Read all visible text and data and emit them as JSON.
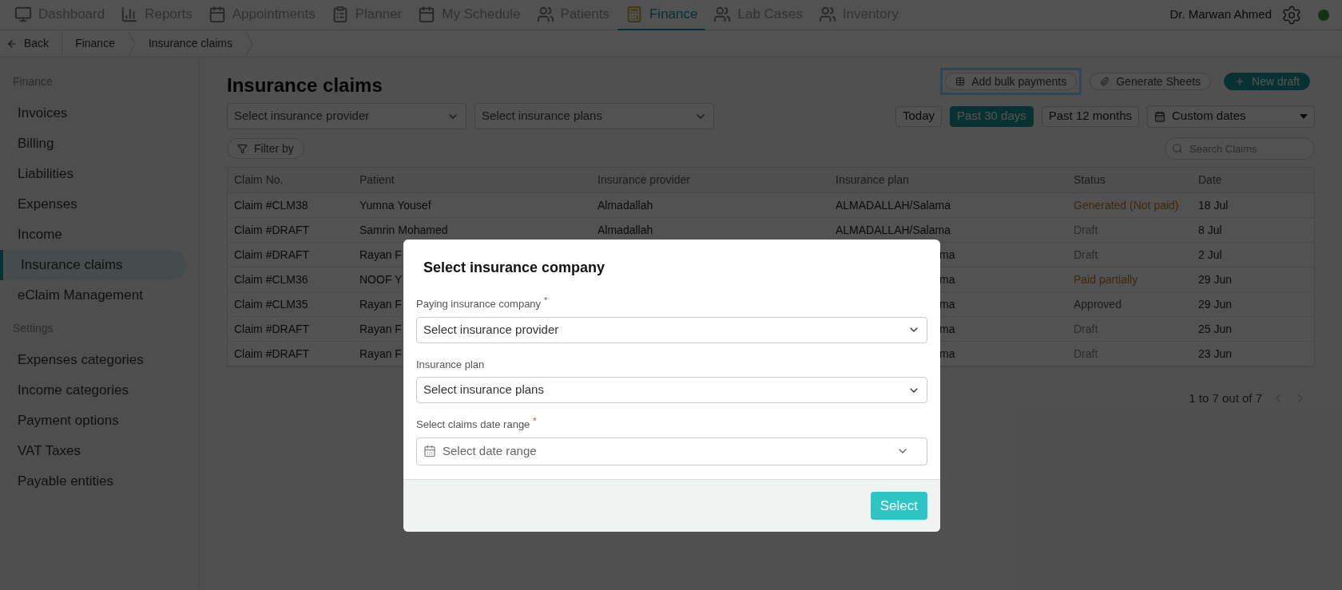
{
  "nav": {
    "items": [
      {
        "label": "Dashboard",
        "selected": false
      },
      {
        "label": "Reports",
        "selected": false
      },
      {
        "label": "Appointments",
        "selected": false
      },
      {
        "label": "Planner",
        "selected": false
      },
      {
        "label": "My Schedule",
        "selected": false
      },
      {
        "label": "Patients",
        "selected": false
      },
      {
        "label": "Finance",
        "selected": true
      },
      {
        "label": "Lab Cases",
        "selected": false
      },
      {
        "label": "Inventory",
        "selected": false
      }
    ],
    "user": "Dr. Marwan Ahmed",
    "online": true
  },
  "breadcrumb": {
    "back": "Back",
    "items": [
      "Finance",
      "Insurance claims"
    ]
  },
  "sidebar": {
    "sections": [
      {
        "title": "Finance",
        "items": [
          {
            "label": "Invoices",
            "selected": false
          },
          {
            "label": "Billing",
            "selected": false
          },
          {
            "label": "Liabilities",
            "selected": false
          },
          {
            "label": "Expenses",
            "selected": false
          },
          {
            "label": "Income",
            "selected": false
          },
          {
            "label": "Insurance claims",
            "selected": true
          },
          {
            "label": "eClaim Management",
            "selected": false
          }
        ]
      },
      {
        "title": "Settings",
        "items": [
          {
            "label": "Expenses categories",
            "selected": false
          },
          {
            "label": "Income categories",
            "selected": false
          },
          {
            "label": "Payment options",
            "selected": false
          },
          {
            "label": "VAT Taxes",
            "selected": false
          },
          {
            "label": "Payable entities",
            "selected": false
          }
        ]
      }
    ]
  },
  "page": {
    "title": "Insurance claims",
    "actions": [
      {
        "label": "Add bulk payments",
        "kind": "bulk",
        "focused": true
      },
      {
        "label": "Generate Sheets",
        "kind": "sheets",
        "focused": false
      },
      {
        "label": "New draft",
        "kind": "primary",
        "focused": false
      }
    ],
    "filters": [
      {
        "placeholder": "Select insurance provider"
      },
      {
        "placeholder": "Select insurance plans"
      }
    ],
    "ranges": [
      {
        "label": "Today",
        "selected": false
      },
      {
        "label": "Past 30 days",
        "selected": true
      },
      {
        "label": "Past 12 months",
        "selected": false
      }
    ],
    "custom_dates": "Custom dates",
    "filter_by": "Filter by",
    "search": {
      "placeholder": "Search Claims"
    }
  },
  "table": {
    "columns": [
      "Claim No.",
      "Patient",
      "Insurance provider",
      "Insurance plan",
      "Status",
      "Date"
    ],
    "rows": [
      {
        "kind": "full",
        "claim": "Claim #CLM38",
        "patient": "Yumna Yousef",
        "provider": "Almadallah",
        "plan": "ALMADALLAH/Salama",
        "status": {
          "label": "Generated (Not paid)",
          "kind": "unpaid"
        },
        "date": "18 Jul"
      },
      {
        "kind": "full",
        "claim": "Claim #DRAFT",
        "patient": "Samrin Mohamed",
        "provider": "Almadallah",
        "plan": "ALMADALLAH/Salama",
        "status": {
          "label": "Draft",
          "kind": "draft"
        },
        "date": "8 Jul"
      },
      {
        "kind": "covered",
        "claim": "Claim #DRAFT",
        "patient": "Rayan F",
        "plan": "ma",
        "status": {
          "label": "Draft",
          "kind": "draft"
        },
        "date": "2 Jul"
      },
      {
        "kind": "covered",
        "claim": "Claim #CLM36",
        "patient": "NOOF Y",
        "plan": "ma",
        "status": {
          "label": "Paid partially",
          "kind": "partial"
        },
        "date": "29 Jun"
      },
      {
        "kind": "covered",
        "claim": "Claim #CLM35",
        "patient": "Rayan F",
        "plan": "ma",
        "status": {
          "label": "Approved",
          "kind": "approved"
        },
        "date": "29 Jun"
      },
      {
        "kind": "covered",
        "claim": "Claim #DRAFT",
        "patient": "Rayan F",
        "plan": "ma",
        "status": {
          "label": "Draft",
          "kind": "draft"
        },
        "date": "25 Jun"
      },
      {
        "kind": "covered",
        "claim": "Claim #DRAFT",
        "patient": "Rayan F",
        "plan": "ma",
        "status": {
          "label": "Draft",
          "kind": "draft"
        },
        "date": "23 Jun"
      }
    ],
    "pagination": "1 to 7 out of 7"
  },
  "dialog": {
    "title": "Select insurance company",
    "fields": [
      {
        "label": "Paying insurance company",
        "required_mark": "*",
        "placeholder": "Select insurance provider",
        "kind": "select"
      },
      {
        "label": "Insurance plan",
        "placeholder": "Select insurance plans",
        "kind": "select"
      },
      {
        "label": "Select claims date range",
        "required_mark": "*",
        "placeholder": "Select date range",
        "kind": "date"
      }
    ],
    "button": "Select"
  }
}
